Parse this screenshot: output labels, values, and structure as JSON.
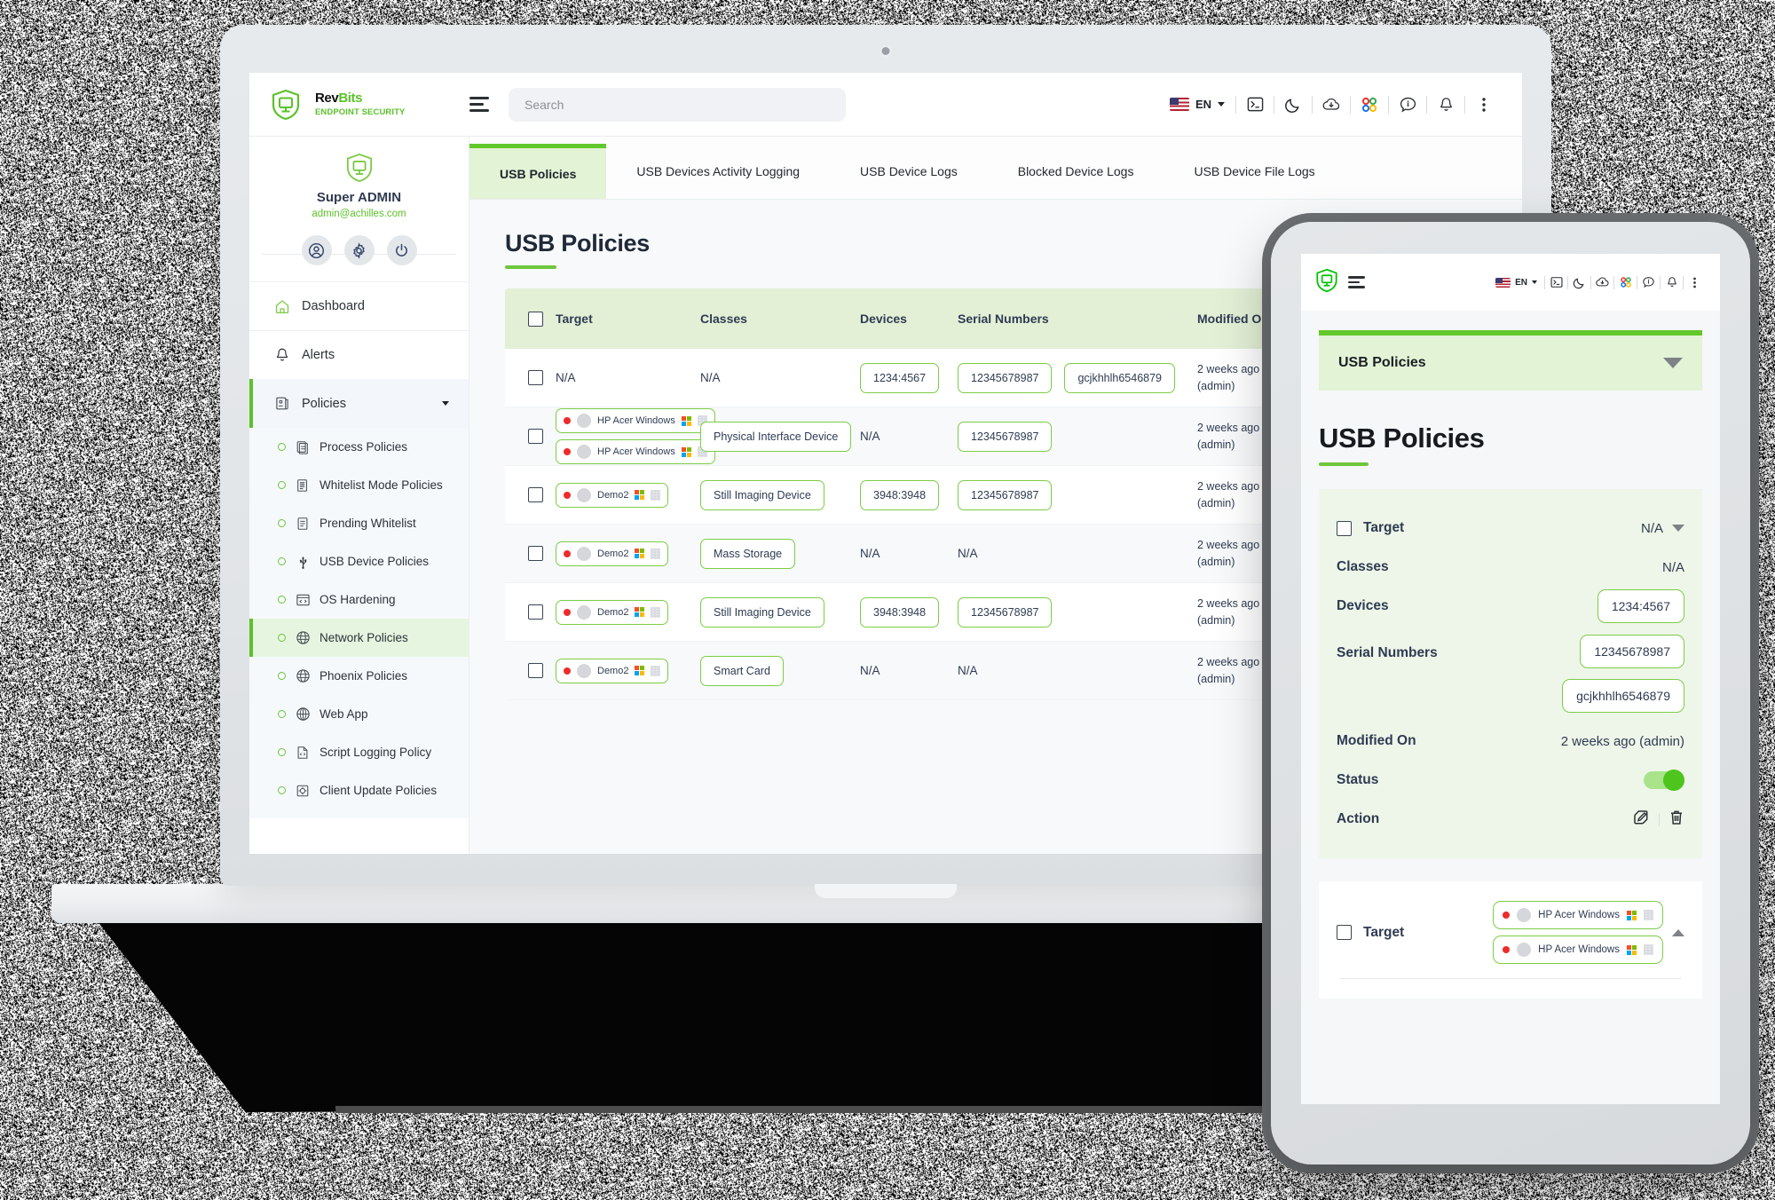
{
  "app": {
    "brand_name_rev": "Rev",
    "brand_name_bits": "Bits",
    "brand_subtitle": "ENDPOINT SECURITY",
    "search_placeholder": "Search",
    "language": "EN"
  },
  "topbar_icons": [
    {
      "name": "terminal-icon",
      "label": "Terminal"
    },
    {
      "name": "moon-icon",
      "label": "Dark Mode"
    },
    {
      "name": "cloud-download-icon",
      "label": "Downloads"
    },
    {
      "name": "apps-grid-icon",
      "label": "Apps"
    },
    {
      "name": "info-icon",
      "label": "Info"
    },
    {
      "name": "bell-icon",
      "label": "Notifications"
    },
    {
      "name": "kebab-menu-icon",
      "label": "More"
    }
  ],
  "sidebar": {
    "user_name": "Super ADMIN",
    "user_email": "admin@achilles.com",
    "user_actions": [
      {
        "name": "profile-icon",
        "label": "Profile"
      },
      {
        "name": "settings-gear-icon",
        "label": "Settings"
      },
      {
        "name": "power-icon",
        "label": "Logout"
      }
    ],
    "items": [
      {
        "label": "Dashboard",
        "icon": "home-icon"
      },
      {
        "label": "Alerts",
        "icon": "bell-icon"
      },
      {
        "label": "Policies",
        "icon": "policy-scroll-icon"
      }
    ],
    "sub_items": [
      {
        "label": "Process Policies",
        "icon": "process-doc-icon",
        "active": false
      },
      {
        "label": "Whitelist Mode Policies",
        "icon": "whitelist-doc-icon",
        "active": false
      },
      {
        "label": "Prending Whitelist",
        "icon": "pending-doc-icon",
        "active": false
      },
      {
        "label": "USB Device Policies",
        "icon": "usb-icon",
        "active": false
      },
      {
        "label": "OS Hardening",
        "icon": "code-window-icon",
        "active": false
      },
      {
        "label": "Network Policies",
        "icon": "globe-network-icon",
        "active": true
      },
      {
        "label": "Phoenix Policies",
        "icon": "globe-network-icon",
        "active": false
      },
      {
        "label": "Web App",
        "icon": "globe-web-icon",
        "active": false
      },
      {
        "label": "Script Logging Policy",
        "icon": "script-doc-icon",
        "active": false
      },
      {
        "label": "Client Update Policies",
        "icon": "client-update-icon",
        "active": false
      }
    ]
  },
  "main": {
    "tabs": [
      {
        "label": "USB  Policies",
        "active": true
      },
      {
        "label": "USB  Devices Activity  Logging",
        "active": false
      },
      {
        "label": "USB Device Logs",
        "active": false
      },
      {
        "label": "Blocked Device Logs",
        "active": false
      },
      {
        "label": "USB Device File Logs",
        "active": false
      }
    ],
    "page_title": "USB Policies",
    "search_placeholder": "Search",
    "columns": [
      "Target",
      "Classes",
      "Devices",
      "Serial Numbers",
      "Modified On"
    ],
    "rows": [
      {
        "targets": [],
        "target_text": "N/A",
        "classes": [],
        "classes_text": "N/A",
        "devices": [
          "1234:4567"
        ],
        "devices_text": "",
        "serials": [
          "12345678987",
          "gcjkhhlh6546879"
        ],
        "serials_text": "",
        "modified": "2 weeks ago",
        "modified_by": "(admin)"
      },
      {
        "targets": [
          "HP Acer Windows",
          "HP Acer Windows"
        ],
        "target_text": "",
        "classes": [
          "Physical Interface Device"
        ],
        "classes_text": "",
        "devices": [],
        "devices_text": "N/A",
        "serials": [
          "12345678987"
        ],
        "serials_text": "",
        "modified": "2 weeks ago",
        "modified_by": "(admin)"
      },
      {
        "targets": [
          "Demo2"
        ],
        "target_text": "",
        "classes": [
          "Still Imaging Device"
        ],
        "classes_text": "",
        "devices": [
          "3948:3948"
        ],
        "devices_text": "",
        "serials": [
          "12345678987"
        ],
        "serials_text": "",
        "modified": "2 weeks ago",
        "modified_by": "(admin)"
      },
      {
        "targets": [
          "Demo2"
        ],
        "target_text": "",
        "classes": [
          "Mass Storage"
        ],
        "classes_text": "",
        "devices": [],
        "devices_text": "N/A",
        "serials": [],
        "serials_text": "N/A",
        "modified": "2 weeks ago",
        "modified_by": "(admin)"
      },
      {
        "targets": [
          "Demo2"
        ],
        "target_text": "",
        "classes": [
          "Still Imaging Device"
        ],
        "classes_text": "",
        "devices": [
          "3948:3948"
        ],
        "devices_text": "",
        "serials": [
          "12345678987"
        ],
        "serials_text": "",
        "modified": "2 weeks ago",
        "modified_by": "(admin)"
      },
      {
        "targets": [
          "Demo2"
        ],
        "target_text": "",
        "classes": [
          "Smart Card"
        ],
        "classes_text": "",
        "devices": [],
        "devices_text": "N/A",
        "serials": [],
        "serials_text": "N/A",
        "modified": "2 weeks ago",
        "modified_by": "(admin)"
      }
    ]
  },
  "mobile": {
    "language": "EN",
    "tab_selected": "USB  Policies",
    "page_title": "USB Policies",
    "card1": {
      "target_label": "Target",
      "target_value": "N/A",
      "classes_label": "Classes",
      "classes_value": "N/A",
      "devices_label": "Devices",
      "devices_values": [
        "1234:4567"
      ],
      "serials_label": "Serial Numbers",
      "serials_values": [
        "12345678987",
        "gcjkhhlh6546879"
      ],
      "modified_label": "Modified On",
      "modified_value": "2 weeks ago (admin)",
      "status_label": "Status",
      "status_on": true,
      "action_label": "Action",
      "actions": [
        {
          "name": "edit-pencil-icon",
          "label": "Edit"
        },
        {
          "name": "trash-delete-icon",
          "label": "Delete"
        }
      ]
    },
    "card2": {
      "target_label": "Target",
      "target_chips": [
        "HP Acer Windows",
        "HP Acer Windows"
      ]
    }
  },
  "colors": {
    "brand_green": "#5cc12a",
    "accent_green": "#6fc63d",
    "tab_active_bg": "#e3f3d6",
    "header_bg": "#e3f0d6",
    "text_navy": "#2f3b52",
    "status_red": "#ee2b2b"
  }
}
